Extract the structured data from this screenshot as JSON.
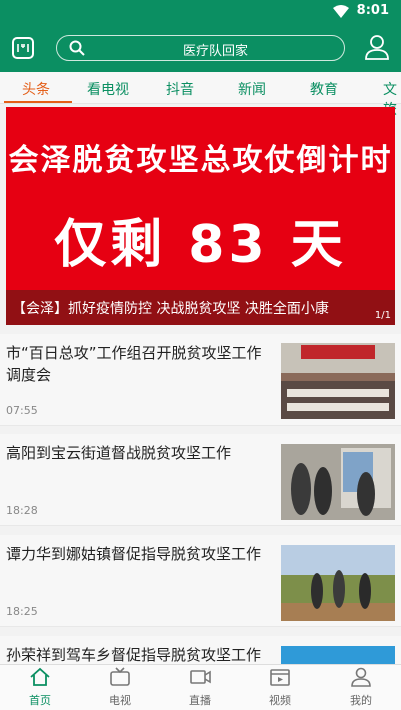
{
  "status_bar": {
    "time": "8:01"
  },
  "search": {
    "placeholder": "医疗队回家"
  },
  "tabs": [
    {
      "label": "头条",
      "active": true
    },
    {
      "label": "看电视"
    },
    {
      "label": "抖音"
    },
    {
      "label": "新闻"
    },
    {
      "label": "教育"
    },
    {
      "label": "文旅"
    }
  ],
  "banner": {
    "line1": "会泽脱贫攻坚总攻仗倒计时",
    "line2": "仅剩 83 天",
    "caption": "【会泽】抓好疫情防控  决战脱贫攻坚  决胜全面小康",
    "pager": "1/1"
  },
  "news": [
    {
      "title": "市“百日总攻”工作组召开脱贫攻坚工作调度会",
      "time": "07:55"
    },
    {
      "title": "高阳到宝云街道督战脱贫攻坚工作",
      "time": "18:28"
    },
    {
      "title": "谭力华到娜姑镇督促指导脱贫攻坚工作",
      "time": "18:25"
    },
    {
      "title": "孙荣祥到驾车乡督促指导脱贫攻坚工作",
      "time": ""
    }
  ],
  "bottom_nav": [
    {
      "label": "首页",
      "icon": "home-icon",
      "active": true
    },
    {
      "label": "电视",
      "icon": "tv-icon"
    },
    {
      "label": "直播",
      "icon": "live-icon"
    },
    {
      "label": "视频",
      "icon": "video-icon"
    },
    {
      "label": "我的",
      "icon": "profile-icon"
    }
  ],
  "colors": {
    "brand_green": "#0b8f62",
    "accent_orange": "#e45f19",
    "banner_red": "#e60012"
  }
}
